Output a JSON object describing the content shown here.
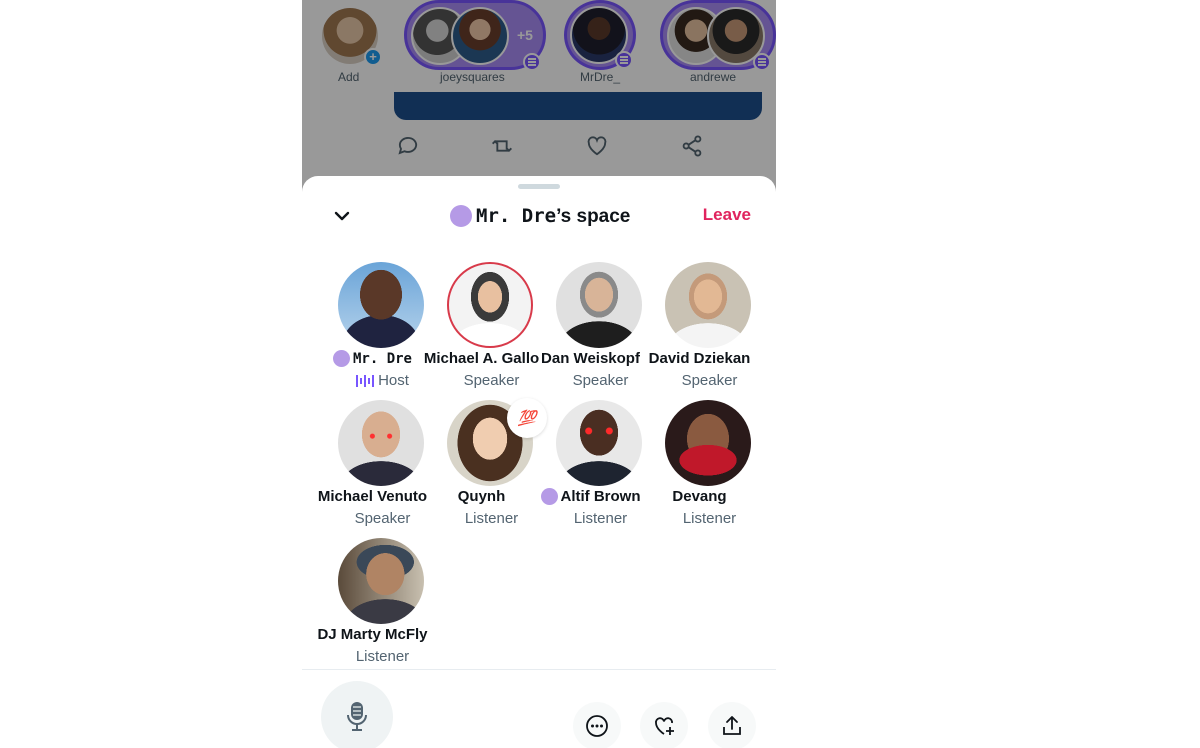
{
  "fleets": [
    {
      "label": "Add",
      "icon": "plus-icon"
    },
    {
      "label": "joeysquares",
      "extra_count": "+5"
    },
    {
      "label": "MrDre_"
    },
    {
      "label": "andrewe"
    }
  ],
  "tweet_actions": [
    "reply-icon",
    "retweet-icon",
    "like-icon",
    "share-icon"
  ],
  "space": {
    "title_prefix": "Mr. Dre",
    "title_suffix": "’s space",
    "leave_label": "Leave",
    "accent": "#e0245e",
    "space_purple": "#7856ff",
    "dot_color": "#b59ae6"
  },
  "participants": [
    {
      "name": "Mr. Dre",
      "role": "Host"
    },
    {
      "name": "Michael A. Gallo",
      "role": "Speaker"
    },
    {
      "name": "Dan Weiskopf",
      "role": "Speaker"
    },
    {
      "name": "David Dziekan",
      "role": "Speaker"
    },
    {
      "name": "Michael Venuto",
      "role": "Speaker"
    },
    {
      "name": "Quynh",
      "role": "Listener",
      "reaction": "💯"
    },
    {
      "name": "Altif Brown",
      "role": "Listener"
    },
    {
      "name": "Devang",
      "role": "Listener"
    },
    {
      "name": "DJ Marty McFly",
      "role": "Listener"
    }
  ],
  "toolbar": [
    "microphone-icon",
    "more-icon",
    "heart-plus-icon",
    "share-icon"
  ]
}
